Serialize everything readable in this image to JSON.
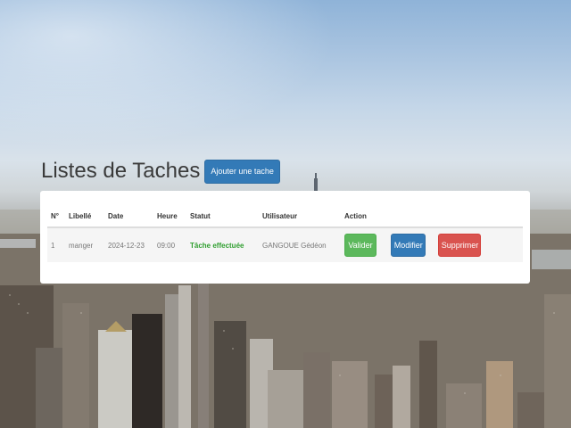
{
  "page": {
    "title": "Listes de Taches",
    "add_button_label": "Ajouter une tache"
  },
  "table": {
    "headers": [
      "N°",
      "Libellé",
      "Date",
      "Heure",
      "Statut",
      "Utilisateur",
      "Action"
    ],
    "rows": [
      {
        "num": "1",
        "libelle": "manger",
        "date": "2024-12-23",
        "heure": "09:00",
        "statut": "Tâche effectuée",
        "utilisateur": "GANGOUE Gédéon",
        "actions": {
          "valider": "Valider",
          "modifier": "Modifier",
          "supprimer": "Supprimer"
        }
      }
    ]
  },
  "colors": {
    "primary": "#337ab7",
    "success": "#5cb85c",
    "danger": "#d9534f",
    "status_done": "#2e9e2e"
  },
  "background": {
    "icon": "city-skyline-photo"
  }
}
